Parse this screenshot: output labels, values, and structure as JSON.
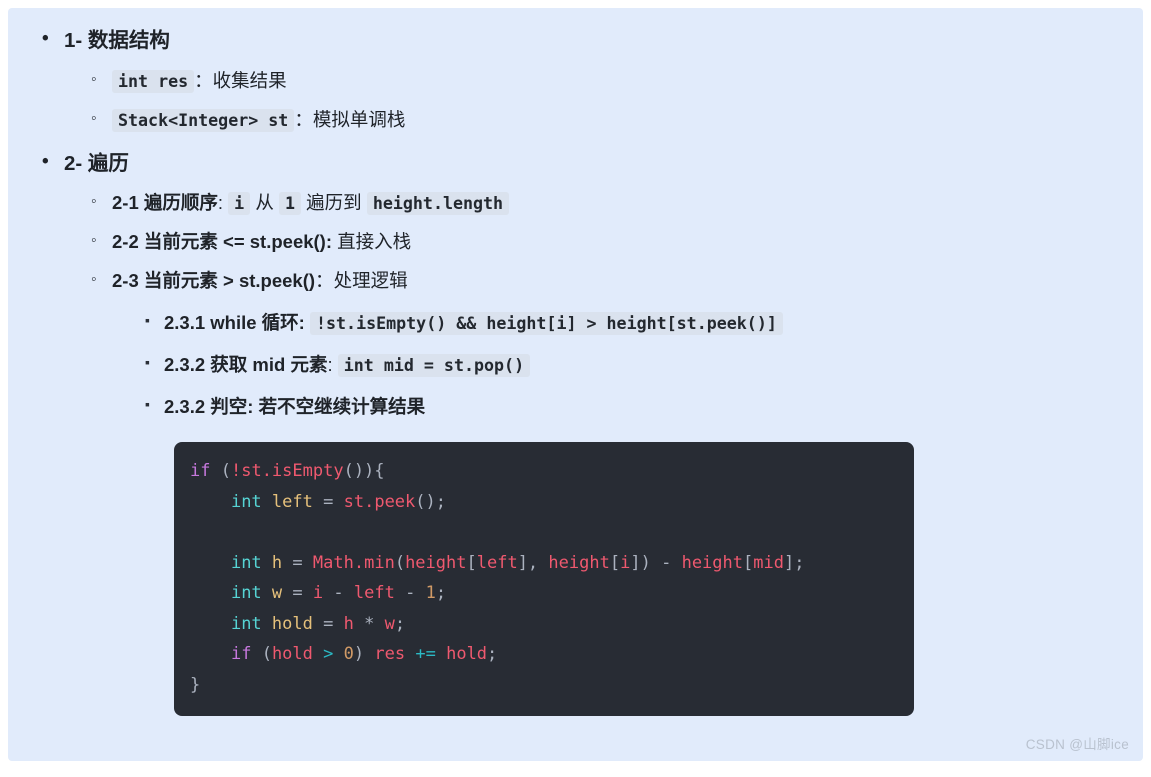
{
  "page": {
    "background_color": "#e1ebfb",
    "watermark": "CSDN @山脚ice"
  },
  "outline": {
    "section1": {
      "title": "1- 数据结构",
      "items": [
        {
          "code": "int res",
          "sep": "：",
          "desc": "收集结果"
        },
        {
          "code": "Stack<Integer> st",
          "sep": "：",
          "desc": "模拟单调栈"
        }
      ]
    },
    "section2": {
      "title": "2- 遍历",
      "item_2_1": {
        "label": "2-1 遍历顺序",
        "sep": ":",
        "code_i": "i",
        "text_from": "从",
        "code_one": "1",
        "text_to": "遍历到",
        "code_len": "height.length"
      },
      "item_2_2": {
        "label": "2-2 当前元素 <= st.peek():",
        "desc": "直接入栈"
      },
      "item_2_3": {
        "label": "2-3 当前元素 > st.peek()",
        "sep": "：",
        "desc": "处理逻辑",
        "sub": [
          {
            "label": "2.3.1 while 循环:",
            "code": "!st.isEmpty() && height[i] > height[st.peek()]"
          },
          {
            "label": "2.3.2 获取 mid 元素",
            "sep": ":",
            "code": "int mid = st.pop()"
          },
          {
            "label": "2.3.2 判空:",
            "desc": "若不空继续计算结果"
          }
        ]
      }
    }
  },
  "code_block": {
    "language": "java",
    "background_color": "#282c34",
    "lines": [
      "if (!st.isEmpty()){",
      "    int left = st.peek();",
      "",
      "    int h = Math.min(height[left], height[i]) - height[mid];",
      "    int w = i - left - 1;",
      "    int hold = h * w;",
      "    if (hold > 0) res += hold;",
      "}"
    ],
    "colors": {
      "keyword": "#c678dd",
      "type": "#56d4d4",
      "variable": "#e5c07b",
      "function": "#ef596f",
      "number": "#d19a66",
      "operator": "#2bbac5",
      "punctuation": "#abb2bf"
    }
  }
}
